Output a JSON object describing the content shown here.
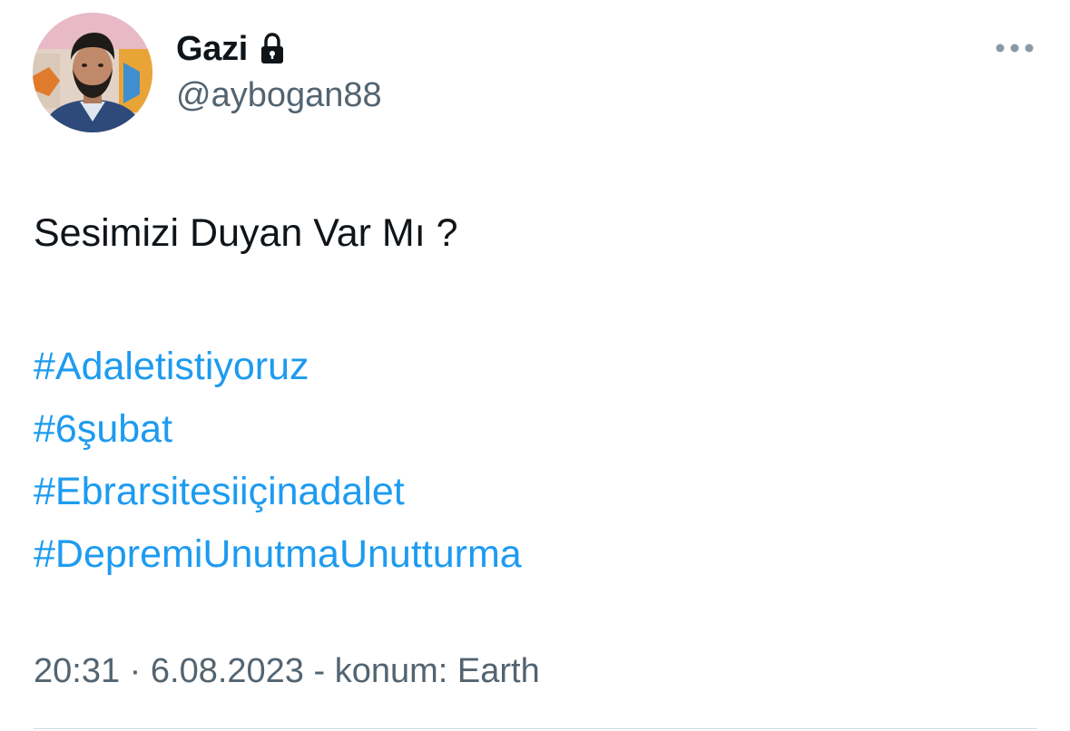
{
  "author": {
    "display_name": "Gazi",
    "handle": "@aybogan88",
    "protected": true,
    "lock_icon": "lock-icon",
    "avatar_icon": "profile-photo"
  },
  "tweet": {
    "text": "Sesimizi Duyan Var Mı ?",
    "hashtags": [
      "#Adaletistiyoruz",
      "#6şubat",
      "#Ebrarsitesiiçinadalet",
      "#DepremiUnutmaUnutturma"
    ],
    "time": "20:31",
    "separator": "·",
    "date": "6.08.2023",
    "location": "- konum: Earth"
  },
  "colors": {
    "text": "#0f1419",
    "secondary": "#536471",
    "hashtag": "#1d9bf0",
    "divider": "#cfd9de"
  },
  "more_icon": "more-horizontal-icon"
}
